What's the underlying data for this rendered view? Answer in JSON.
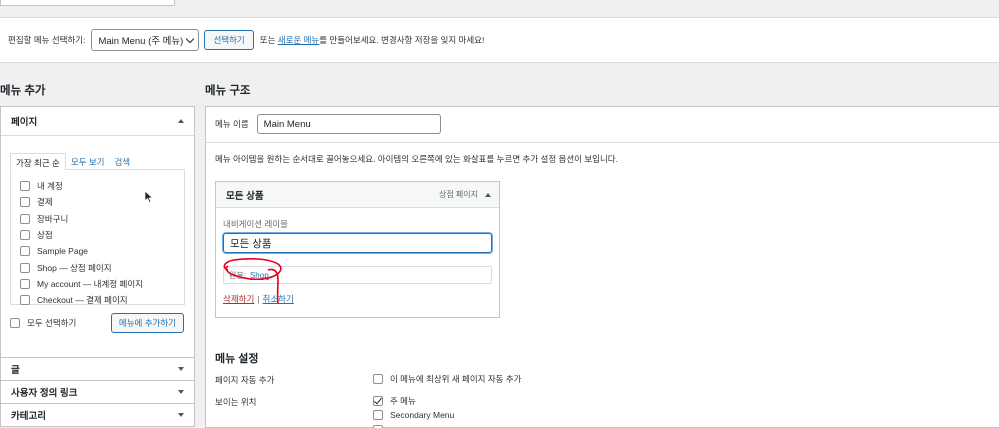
{
  "manage": {
    "select_label": "편집할 메뉴 선택하기:",
    "selected_menu": "Main Menu (주 메뉴)",
    "select_button": "선택하기",
    "text_before": "또는",
    "create_link": "새로운 메뉴",
    "text_after": "를 만들어보세요. 변경사항 저장을 잊지 마세요!"
  },
  "left": {
    "heading": "메뉴 추가",
    "pages_section": {
      "title": "페이지",
      "tabs": [
        "가장 최근 순",
        "모두 보기",
        "검색"
      ],
      "items": [
        "내 계정",
        "결제",
        "장바구니",
        "상점",
        "Sample Page",
        "Shop — 상점 페이지",
        "My account — 내계정 페이지",
        "Checkout — 결제 페이지"
      ],
      "select_all": "모두 선택하기",
      "add_button": "메뉴에 추가하기"
    },
    "closed_sections": [
      "글",
      "사용자 정의 링크",
      "카테고리"
    ]
  },
  "right": {
    "heading": "메뉴 구조",
    "name_label": "메뉴 이름",
    "name_value": "Main Menu",
    "instructions": "메뉴 아이템을 원하는 순서대로 끌어놓으세요. 아이템의 오른쪽에 있는 화살표를 누르면 추가 설정 옵션이 보입니다.",
    "item": {
      "title": "모든 상품",
      "type": "상점 페이지",
      "nav_label_caption": "내비게이션 레이블",
      "nav_label_value": "모든 상품",
      "original_label": "원본:",
      "original_link": "Shop",
      "delete": "삭제하기",
      "separator": "|",
      "cancel": "취소하기"
    },
    "settings": {
      "heading": "메뉴 설정",
      "auto_add_label": "페이지 자동 추가",
      "auto_add_option": "이 메뉴에 최상위 새 페이지 자동 추가",
      "location_label": "보이는 위치",
      "locations": [
        {
          "label": "주 메뉴",
          "checked": true
        },
        {
          "label": "Secondary Menu",
          "checked": false
        },
        {
          "label": "",
          "checked": false
        }
      ]
    }
  },
  "colors": {
    "accent": "#2271b1",
    "delete": "#b32d2e",
    "annotation": "#e0001b"
  }
}
